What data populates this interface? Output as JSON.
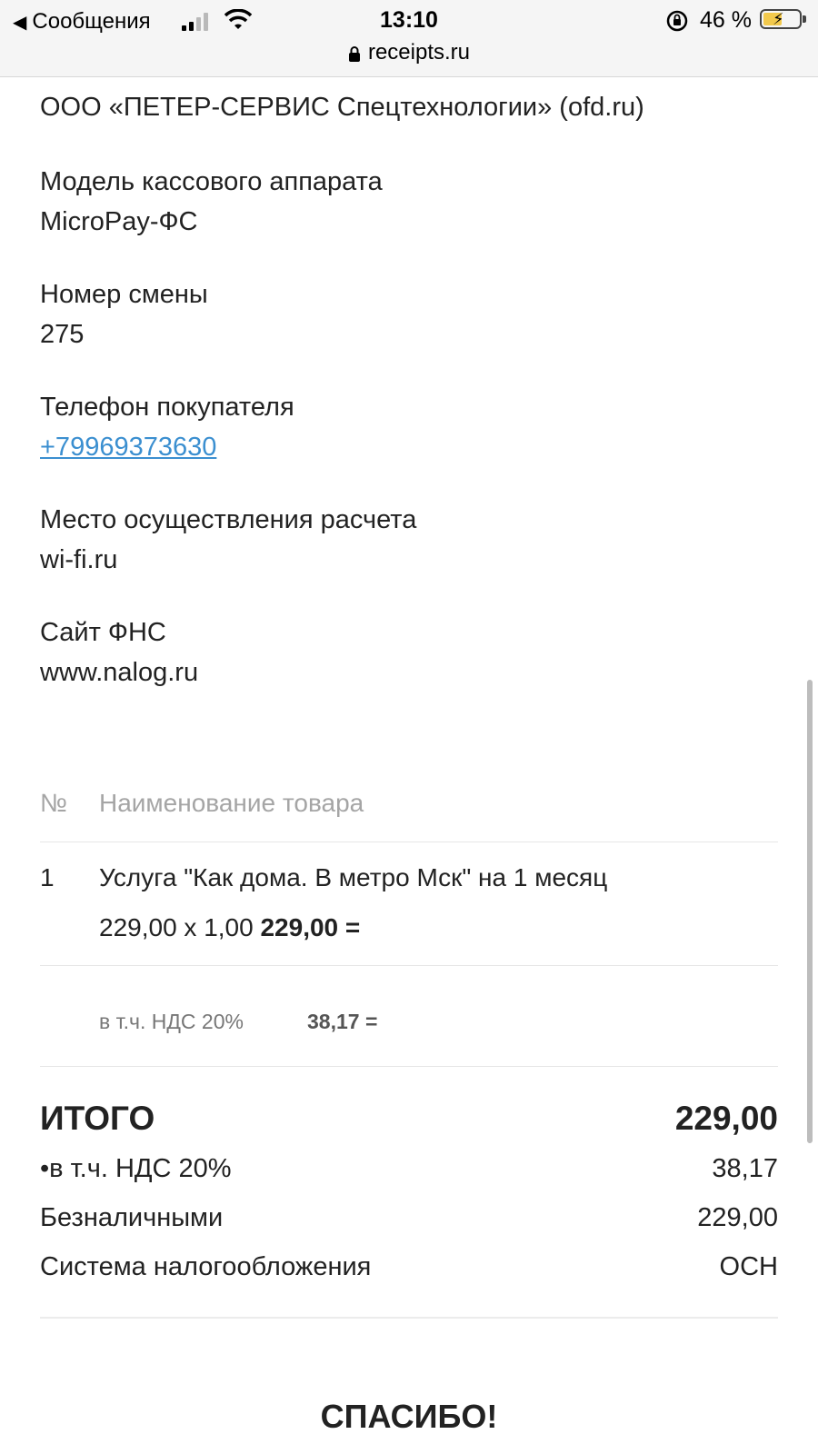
{
  "status_bar": {
    "back_label": "Сообщения",
    "time": "13:10",
    "battery_percent": "46 %",
    "battery_level": 0.46,
    "signal_bars": 4,
    "signal_active": 2
  },
  "address_bar": {
    "url": "receipts.ru"
  },
  "receipt": {
    "ofd_operator": "ООО «ПЕТЕР-СЕРВИС Спецтехнологии» (ofd.ru)",
    "fields": [
      {
        "label": "Модель кассового аппарата",
        "value": "MicroPay-ФС"
      },
      {
        "label": "Номер смены",
        "value": "275"
      },
      {
        "label": "Телефон покупателя",
        "value": "+79969373630"
      },
      {
        "label": "Место осуществления расчета",
        "value": "wi-fi.ru"
      },
      {
        "label": "Сайт ФНС",
        "value": "www.nalog.ru"
      }
    ],
    "items_table": {
      "headers": {
        "num": "№",
        "name": "Наименование товара"
      },
      "rows": [
        {
          "num": "1",
          "name": "Услуга \"Как дома. В метро Мск\" на 1 месяц",
          "price_qty": "229,00 х 1,00",
          "sum": "229,00 ="
        }
      ],
      "vat_label": "в т.ч. НДС 20%",
      "vat_value": "38,17 ="
    },
    "totals": [
      {
        "label": "ИТОГО",
        "value": "229,00"
      },
      {
        "label": "•в т.ч. НДС 20%",
        "value": "38,17"
      },
      {
        "label": "Безналичными",
        "value": "229,00"
      },
      {
        "label": "Система налогообложения",
        "value": "ОСН"
      }
    ],
    "thanks": "СПАСИБО!"
  }
}
